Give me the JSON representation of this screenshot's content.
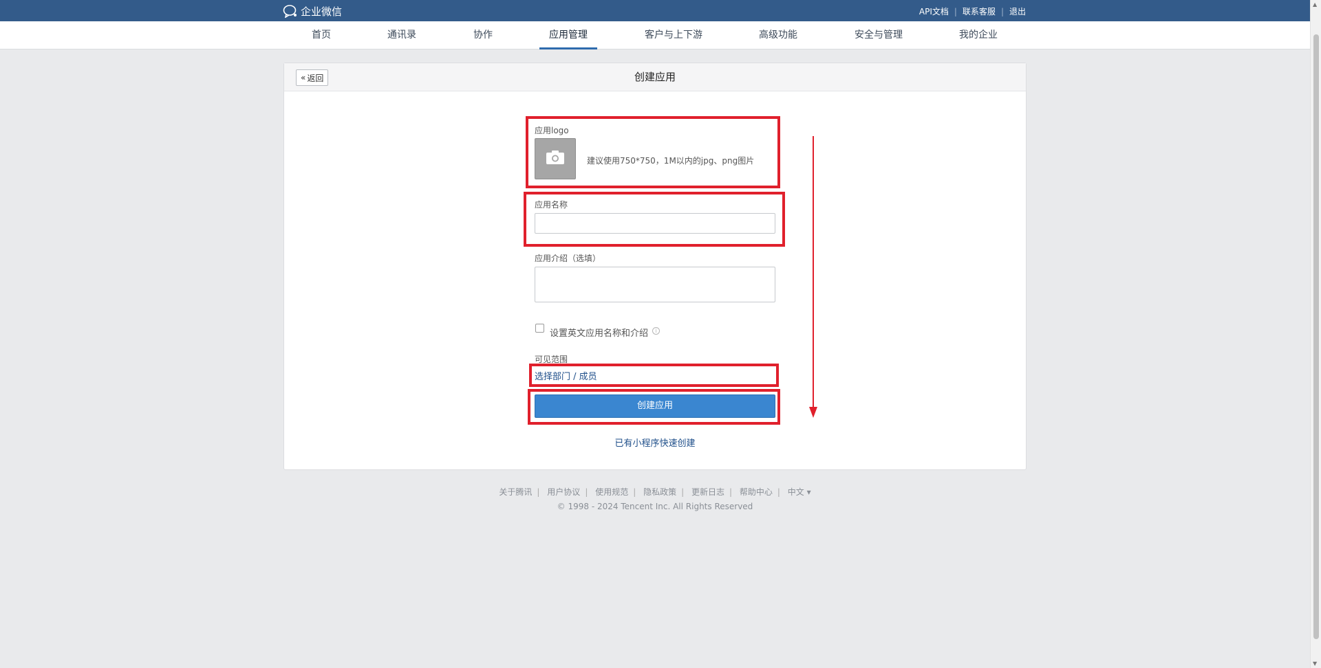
{
  "topbar": {
    "brand": "企业微信",
    "links": [
      "API文档",
      "联系客服",
      "退出"
    ],
    "bg_color": "#335b8a"
  },
  "nav": {
    "items": [
      "首页",
      "通讯录",
      "协作",
      "应用管理",
      "客户与上下游",
      "高级功能",
      "安全与管理",
      "我的企业"
    ],
    "active": "应用管理"
  },
  "card": {
    "back_label": "返回",
    "title": "创建应用"
  },
  "form": {
    "logo_label": "应用logo",
    "logo_hint": "建议使用750*750，1M以内的jpg、png图片",
    "name_label": "应用名称",
    "name_value": "",
    "intro_label": "应用介绍（选填）",
    "intro_value": "",
    "english_checkbox_label": "设置英文应用名称和介绍",
    "english_checked": false,
    "scope_label": "可见范围",
    "scope_link": "选择部门 / 成员",
    "submit_label": "创建应用",
    "miniprogram_link": "已有小程序快速创建"
  },
  "footer": {
    "links": [
      "关于腾讯",
      "用户协议",
      "使用规范",
      "隐私政策",
      "更新日志",
      "帮助中心",
      "中文 ▾"
    ],
    "copyright": "© 1998 - 2024 Tencent Inc. All Rights Reserved"
  },
  "annotation_color": "#e0202c"
}
